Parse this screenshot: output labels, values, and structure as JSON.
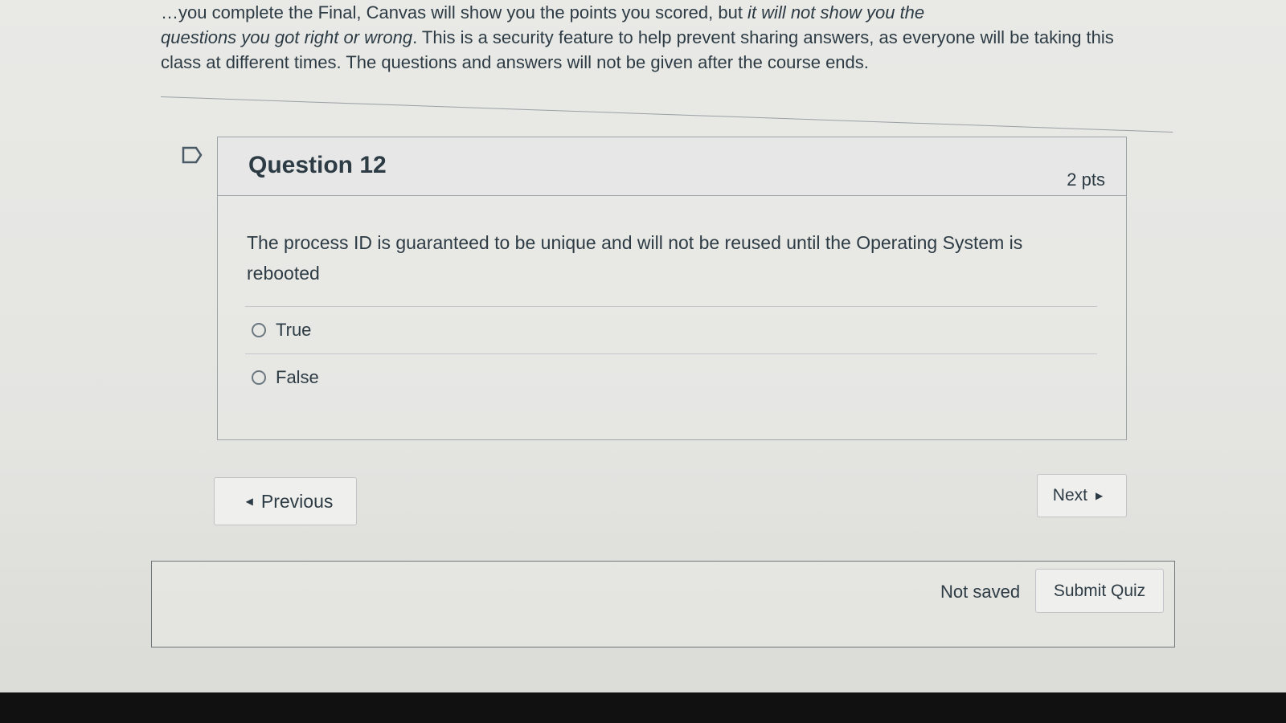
{
  "intro": {
    "line1": "…you complete the Final, Canvas will show you the points you scored, but",
    "line1_em": " it will not show you the",
    "line2_em": "questions you got right or wrong",
    "line2": ". This is a security feature to help prevent sharing answers, as everyone will be taking this",
    "line3": "class at different times. The questions and answers will not be given after the course ends."
  },
  "question": {
    "title": "Question 12",
    "points": "2 pts",
    "text": "The process ID is guaranteed to be unique and will not be reused until the Operating System is rebooted",
    "answers": [
      {
        "label": "True",
        "selected": false
      },
      {
        "label": "False",
        "selected": false
      }
    ]
  },
  "nav": {
    "previous_label": "Previous",
    "next_label": "Next"
  },
  "footer": {
    "status": "Not saved",
    "submit_label": "Submit Quiz"
  },
  "icons": {
    "flag": "bookmark-flag-icon",
    "prev": "caret-left-icon",
    "next": "caret-right-icon",
    "radio": "radio-button-icon"
  }
}
